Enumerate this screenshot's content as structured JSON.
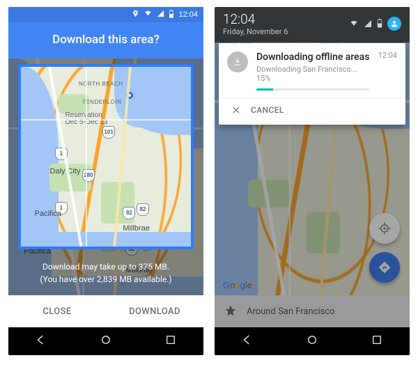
{
  "left": {
    "status": {
      "time": "12:04"
    },
    "title": "Download this area?",
    "map": {
      "labels": {
        "north_beach": "NORTH BEACH",
        "tenderloin": "TENDERLOIN",
        "reservation": "Reservation",
        "reservation_dates": "Dec 5-Dec 13",
        "daly_city": "Daly City",
        "pacifica": "Pacifica",
        "millbrae": "Millbrae"
      },
      "shields": {
        "s1": "1",
        "s2": "280",
        "s3": "82",
        "s4": "82",
        "s5": "101",
        "s6": "1"
      }
    },
    "info_line1": "Download may take up to 375 MB.",
    "info_line2": "(You have over 2,839 MB available.)",
    "close_label": "CLOSE",
    "download_label": "DOWNLOAD"
  },
  "right": {
    "shade": {
      "time": "12:04",
      "date": "Friday, November 6"
    },
    "notif": {
      "title": "Downloading offline areas",
      "sub": "Downloading San Francisco... 15%",
      "time": "12:04",
      "progress_pct": 15,
      "cancel_label": "CANCEL"
    },
    "explore_label": "Around San Francisco",
    "logo": "Google"
  }
}
